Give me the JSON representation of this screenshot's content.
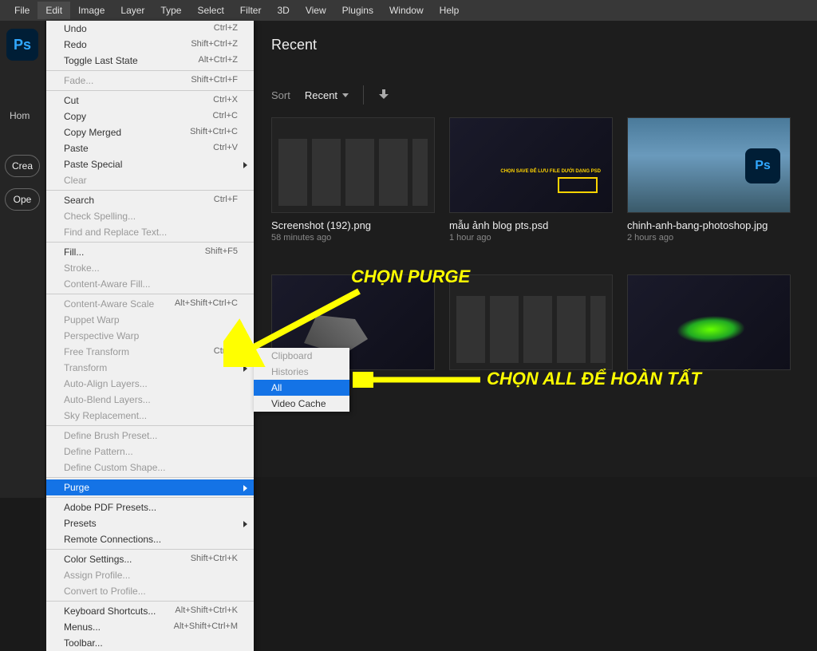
{
  "menubar": [
    "File",
    "Edit",
    "Image",
    "Layer",
    "Type",
    "Select",
    "Filter",
    "3D",
    "View",
    "Plugins",
    "Window",
    "Help"
  ],
  "menubar_active_index": 1,
  "rail": {
    "home": "Hom",
    "create": "Crea",
    "open": "Ope"
  },
  "content": {
    "title": "Recent",
    "sort_label": "Sort",
    "sort_value": "Recent"
  },
  "thumbs_row1": [
    {
      "title": "Screenshot (192).png",
      "time": "58 minutes ago",
      "kind": "panels"
    },
    {
      "title": "mẫu ảnh blog pts.psd",
      "time": "1 hour ago",
      "kind": "dark"
    },
    {
      "title": "chinh-anh-bang-photoshop.jpg",
      "time": "2 hours ago",
      "kind": "sky"
    }
  ],
  "thumbs_row2": [
    {
      "kind": "ship"
    },
    {
      "kind": "panels"
    },
    {
      "kind": "green"
    }
  ],
  "edit_menu": [
    {
      "label": "Undo",
      "shortcut": "Ctrl+Z"
    },
    {
      "label": "Redo",
      "shortcut": "Shift+Ctrl+Z"
    },
    {
      "label": "Toggle Last State",
      "shortcut": "Alt+Ctrl+Z"
    },
    {
      "sep": true
    },
    {
      "label": "Fade...",
      "shortcut": "Shift+Ctrl+F",
      "disabled": true
    },
    {
      "sep": true
    },
    {
      "label": "Cut",
      "shortcut": "Ctrl+X"
    },
    {
      "label": "Copy",
      "shortcut": "Ctrl+C"
    },
    {
      "label": "Copy Merged",
      "shortcut": "Shift+Ctrl+C"
    },
    {
      "label": "Paste",
      "shortcut": "Ctrl+V"
    },
    {
      "label": "Paste Special",
      "submenu": true
    },
    {
      "label": "Clear",
      "disabled": true
    },
    {
      "sep": true
    },
    {
      "label": "Search",
      "shortcut": "Ctrl+F"
    },
    {
      "label": "Check Spelling...",
      "disabled": true
    },
    {
      "label": "Find and Replace Text...",
      "disabled": true
    },
    {
      "sep": true
    },
    {
      "label": "Fill...",
      "shortcut": "Shift+F5"
    },
    {
      "label": "Stroke...",
      "disabled": true
    },
    {
      "label": "Content-Aware Fill...",
      "disabled": true
    },
    {
      "sep": true
    },
    {
      "label": "Content-Aware Scale",
      "shortcut": "Alt+Shift+Ctrl+C",
      "disabled": true
    },
    {
      "label": "Puppet Warp",
      "disabled": true
    },
    {
      "label": "Perspective Warp",
      "disabled": true
    },
    {
      "label": "Free Transform",
      "shortcut": "Ctrl+T",
      "disabled": true
    },
    {
      "label": "Transform",
      "submenu": true,
      "disabled": true
    },
    {
      "label": "Auto-Align Layers...",
      "disabled": true
    },
    {
      "label": "Auto-Blend Layers...",
      "disabled": true
    },
    {
      "label": "Sky Replacement...",
      "disabled": true
    },
    {
      "sep": true
    },
    {
      "label": "Define Brush Preset...",
      "disabled": true
    },
    {
      "label": "Define Pattern...",
      "disabled": true
    },
    {
      "label": "Define Custom Shape...",
      "disabled": true
    },
    {
      "sep": true
    },
    {
      "label": "Purge",
      "submenu": true,
      "highlight": true
    },
    {
      "sep": true
    },
    {
      "label": "Adobe PDF Presets..."
    },
    {
      "label": "Presets",
      "submenu": true
    },
    {
      "label": "Remote Connections..."
    },
    {
      "sep": true
    },
    {
      "label": "Color Settings...",
      "shortcut": "Shift+Ctrl+K"
    },
    {
      "label": "Assign Profile...",
      "disabled": true
    },
    {
      "label": "Convert to Profile...",
      "disabled": true
    },
    {
      "sep": true
    },
    {
      "label": "Keyboard Shortcuts...",
      "shortcut": "Alt+Shift+Ctrl+K"
    },
    {
      "label": "Menus...",
      "shortcut": "Alt+Shift+Ctrl+M"
    },
    {
      "label": "Toolbar..."
    }
  ],
  "purge_submenu": [
    {
      "label": "Clipboard",
      "disabled": true
    },
    {
      "label": "Histories",
      "disabled": true
    },
    {
      "label": "All",
      "highlight": true
    },
    {
      "label": "Video Cache"
    }
  ],
  "annotations": {
    "purge": "CHỌN PURGE",
    "all": "CHỌN ALL ĐỂ HOÀN TẤT"
  }
}
